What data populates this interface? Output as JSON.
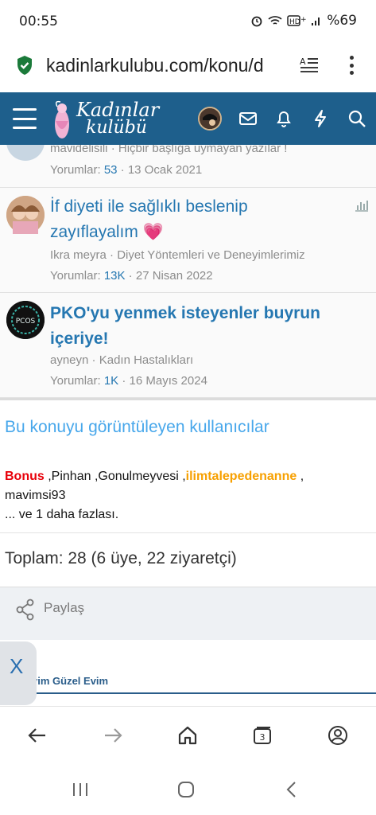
{
  "status_bar": {
    "time": "00:55",
    "battery": "%69"
  },
  "url_bar": {
    "url": "kadinlarkulubu.com/konu/d"
  },
  "header": {
    "logo_line1": "Kadınlar",
    "logo_line2": "kulübü"
  },
  "threads": [
    {
      "author": "mavidelisili",
      "forum": "Hiçbir başlığa uymayan yazılar !",
      "replies_label": "Yorumlar:",
      "replies": "53",
      "date": "13 Ocak 2021"
    },
    {
      "title": "İf diyeti ile sağlıklı beslenip zayıflayalım",
      "emoji": "💗",
      "author": "Ikra meyra",
      "forum": "Diyet Yöntemleri ve Deneyimlerimiz",
      "replies_label": "Yorumlar:",
      "replies": "13K",
      "date": "27 Nisan 2022"
    },
    {
      "title": "PKO'yu yenmek isteyenler buyrun içeriye!",
      "author": "ayneyn",
      "forum": "Kadın Hastalıkları",
      "replies_label": "Yorumlar:",
      "replies": "1K",
      "date": "16 Mayıs 2024",
      "avatar_text": "PCOS"
    }
  ],
  "viewers": {
    "heading": "Bu konuyu görüntüleyen kullanıcılar",
    "users": [
      "Bonus",
      "Pinhan",
      "Gonulmeyvesi",
      "ilimtalepedenanne",
      "mavimsi93"
    ],
    "more": "... ve 1 daha fazlası."
  },
  "total": {
    "text": "Toplam: 28 (6 üye, 22 ziyaretçi)"
  },
  "share": {
    "label": "Paylaş"
  },
  "ad": {
    "close": "X",
    "banner_text": "vim Güzel Evim"
  },
  "bottom_nav": {
    "tab_count": "3"
  },
  "colors": {
    "header_bg": "#1e5f8c",
    "link": "#2577b1",
    "viewers_heading": "#47a7eb",
    "bonus_user": "#e8000a",
    "ilim_user": "#f7a000"
  }
}
